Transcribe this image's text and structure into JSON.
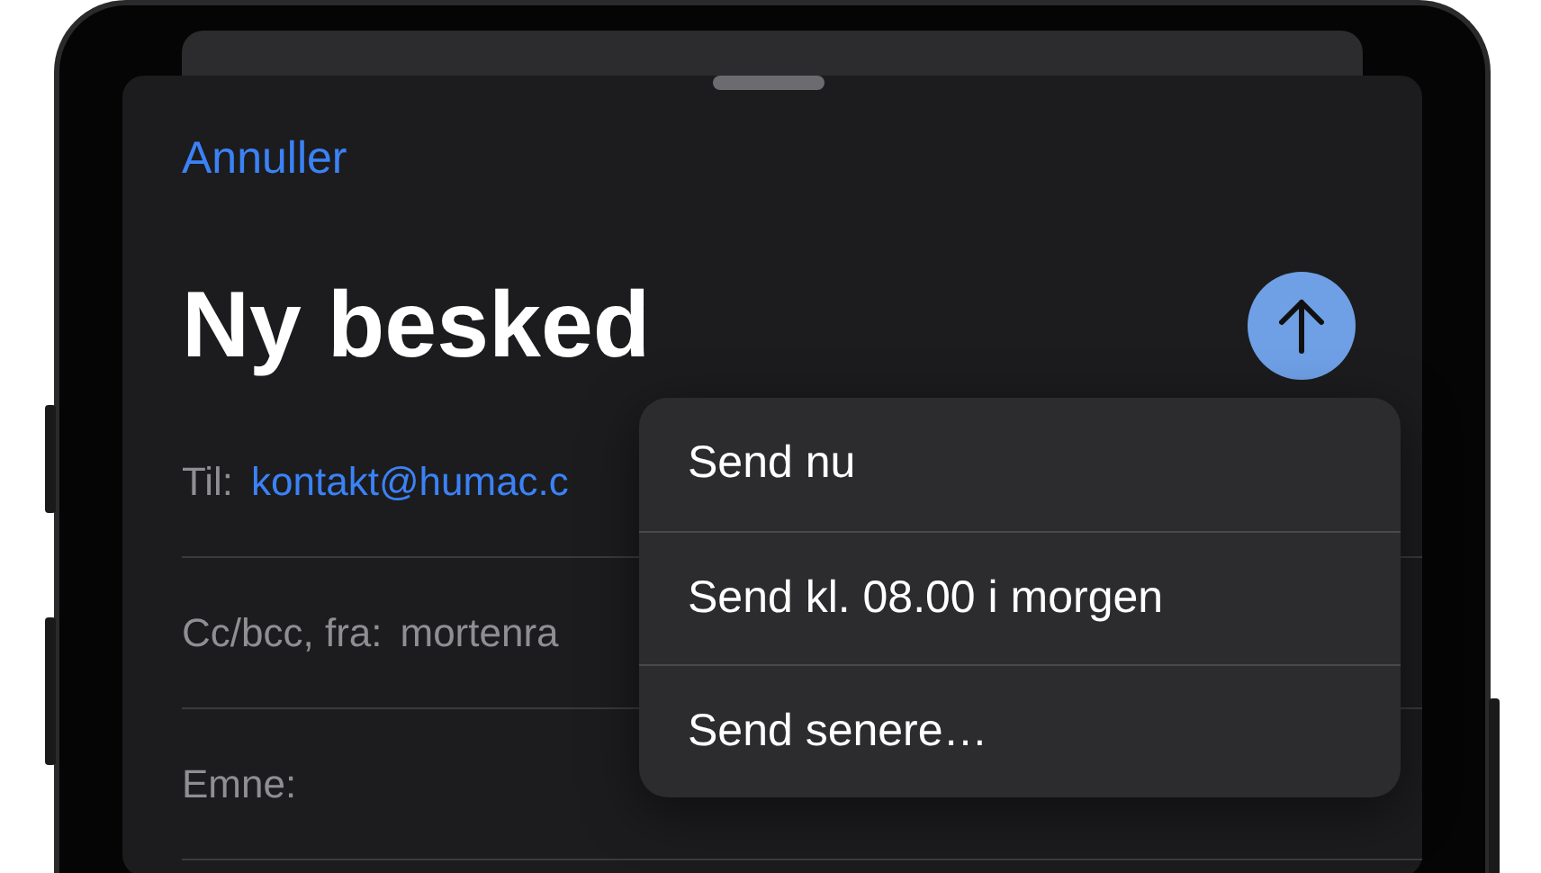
{
  "compose": {
    "cancel": "Annuller",
    "title": "Ny besked"
  },
  "fields": [
    {
      "label": "Til:",
      "value": "kontakt@humac.c",
      "kind": "link"
    },
    {
      "label": "Cc/bcc, fra:",
      "value": "mortenra",
      "kind": "plain"
    },
    {
      "label": "Emne:"
    }
  ],
  "send_menu": [
    {
      "label": "Send nu"
    },
    {
      "label": "Send kl. 08.00 i morgen"
    },
    {
      "label": "Send senere…"
    }
  ]
}
